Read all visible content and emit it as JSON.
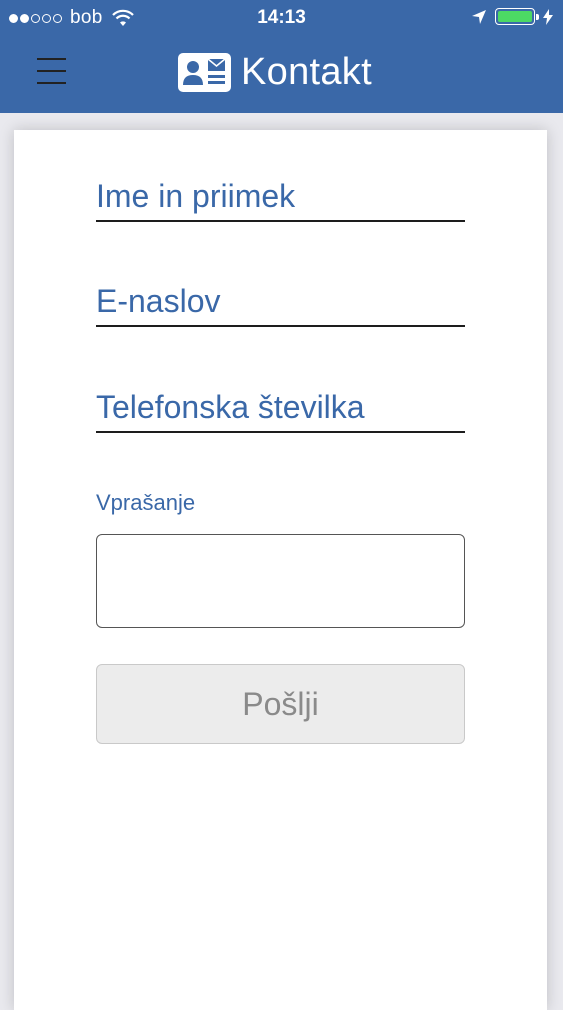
{
  "status_bar": {
    "carrier": "bob",
    "time": "14:13",
    "signal_bars_filled": 2,
    "signal_bars_total": 5,
    "battery_level": 1.0,
    "battery_color": "#4cd964",
    "icons": [
      "wifi-icon",
      "location-arrow-icon",
      "battery-icon",
      "charging-bolt-icon"
    ]
  },
  "header": {
    "title": "Kontakt",
    "background_color": "#3a68a8",
    "menu_icon": "hamburger-menu-icon",
    "title_icon": "contact-card-icon"
  },
  "form": {
    "name_placeholder": "Ime in priimek",
    "email_placeholder": "E-naslov",
    "phone_placeholder": "Telefonska številka",
    "question_label": "Vprašanje",
    "question_value": "",
    "submit_label": "Pošlji",
    "accent_color": "#3a68a8"
  }
}
